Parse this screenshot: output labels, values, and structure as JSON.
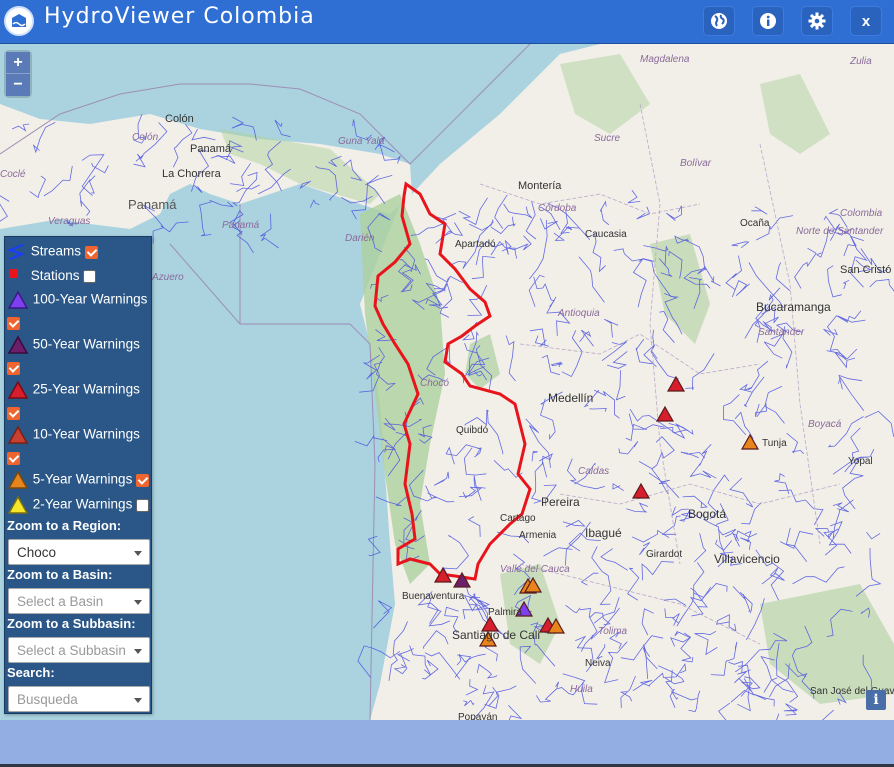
{
  "app": {
    "title": "HydroViewer Colombia",
    "header_buttons": [
      {
        "icon": "globe-icon"
      },
      {
        "icon": "info-icon"
      },
      {
        "icon": "gear-icon"
      },
      {
        "label": "x"
      }
    ]
  },
  "map": {
    "zoom_in": "+",
    "zoom_out": "−",
    "attribution_button": "i",
    "place_labels": [
      "Colón",
      "Panamá",
      "La Chorrera",
      "Panamá",
      "Darién",
      "Apartadó",
      "Montería",
      "Magdalena",
      "Zulia",
      "Sucre",
      "Bolívar",
      "Córdoba",
      "Caucasia",
      "Ocaña",
      "Colombia",
      "Norte de Santander",
      "San Cristó",
      "Bucaramanga",
      "Santander",
      "Antioquia",
      "Medellín",
      "Chocó",
      "Quibdó",
      "Boyacá",
      "Tunja",
      "Yopal",
      "Caldas",
      "Pereira",
      "Cartago",
      "Armenia",
      "Ibagué",
      "Bogotá",
      "Girardot",
      "Villavicencio",
      "Valle del Cauca",
      "Buenaventura",
      "Palmira",
      "Santiago de Cali",
      "Tolima",
      "Neiva",
      "Huila",
      "San José del Guaviare",
      "Popayán",
      "Guna Yala",
      "Veraguas",
      "Coclé",
      "Panamá",
      "Colón",
      "Azuero"
    ],
    "region_color": "#e8141c",
    "stream_color": "#4a52e0",
    "warning_colors": {
      "100_year": "#7d3ff0",
      "50_year": "#6b1f6b",
      "25_year": "#d61e2c",
      "10_year": "#c8402f",
      "5_year": "#e8841c",
      "2_year": "#f5e62a"
    }
  },
  "legend": {
    "layers": [
      {
        "label": "Streams",
        "checked": true,
        "icon": "stream-icon"
      },
      {
        "label": "Stations",
        "checked": false,
        "icon": "station-icon"
      },
      {
        "label": "100-Year Warnings",
        "checked": true,
        "icon": "warning-100-icon"
      },
      {
        "label": "50-Year Warnings",
        "checked": true,
        "icon": "warning-50-icon"
      },
      {
        "label": "25-Year Warnings",
        "checked": true,
        "icon": "warning-25-icon"
      },
      {
        "label": "10-Year Warnings",
        "checked": true,
        "icon": "warning-10-icon"
      },
      {
        "label": "5-Year Warnings",
        "checked": true,
        "icon": "warning-5-icon"
      },
      {
        "label": "2-Year Warnings",
        "checked": false,
        "icon": "warning-2-icon"
      }
    ],
    "zoom_region_label": "Zoom to a Region:",
    "zoom_region_value": "Choco",
    "zoom_basin_label": "Zoom to a Basin:",
    "zoom_basin_placeholder": "Select a Basin",
    "zoom_subbasin_label": "Zoom to a Subbasin:",
    "zoom_subbasin_placeholder": "Select a Subbasin",
    "search_label": "Search:",
    "search_placeholder": "Busqueda"
  }
}
